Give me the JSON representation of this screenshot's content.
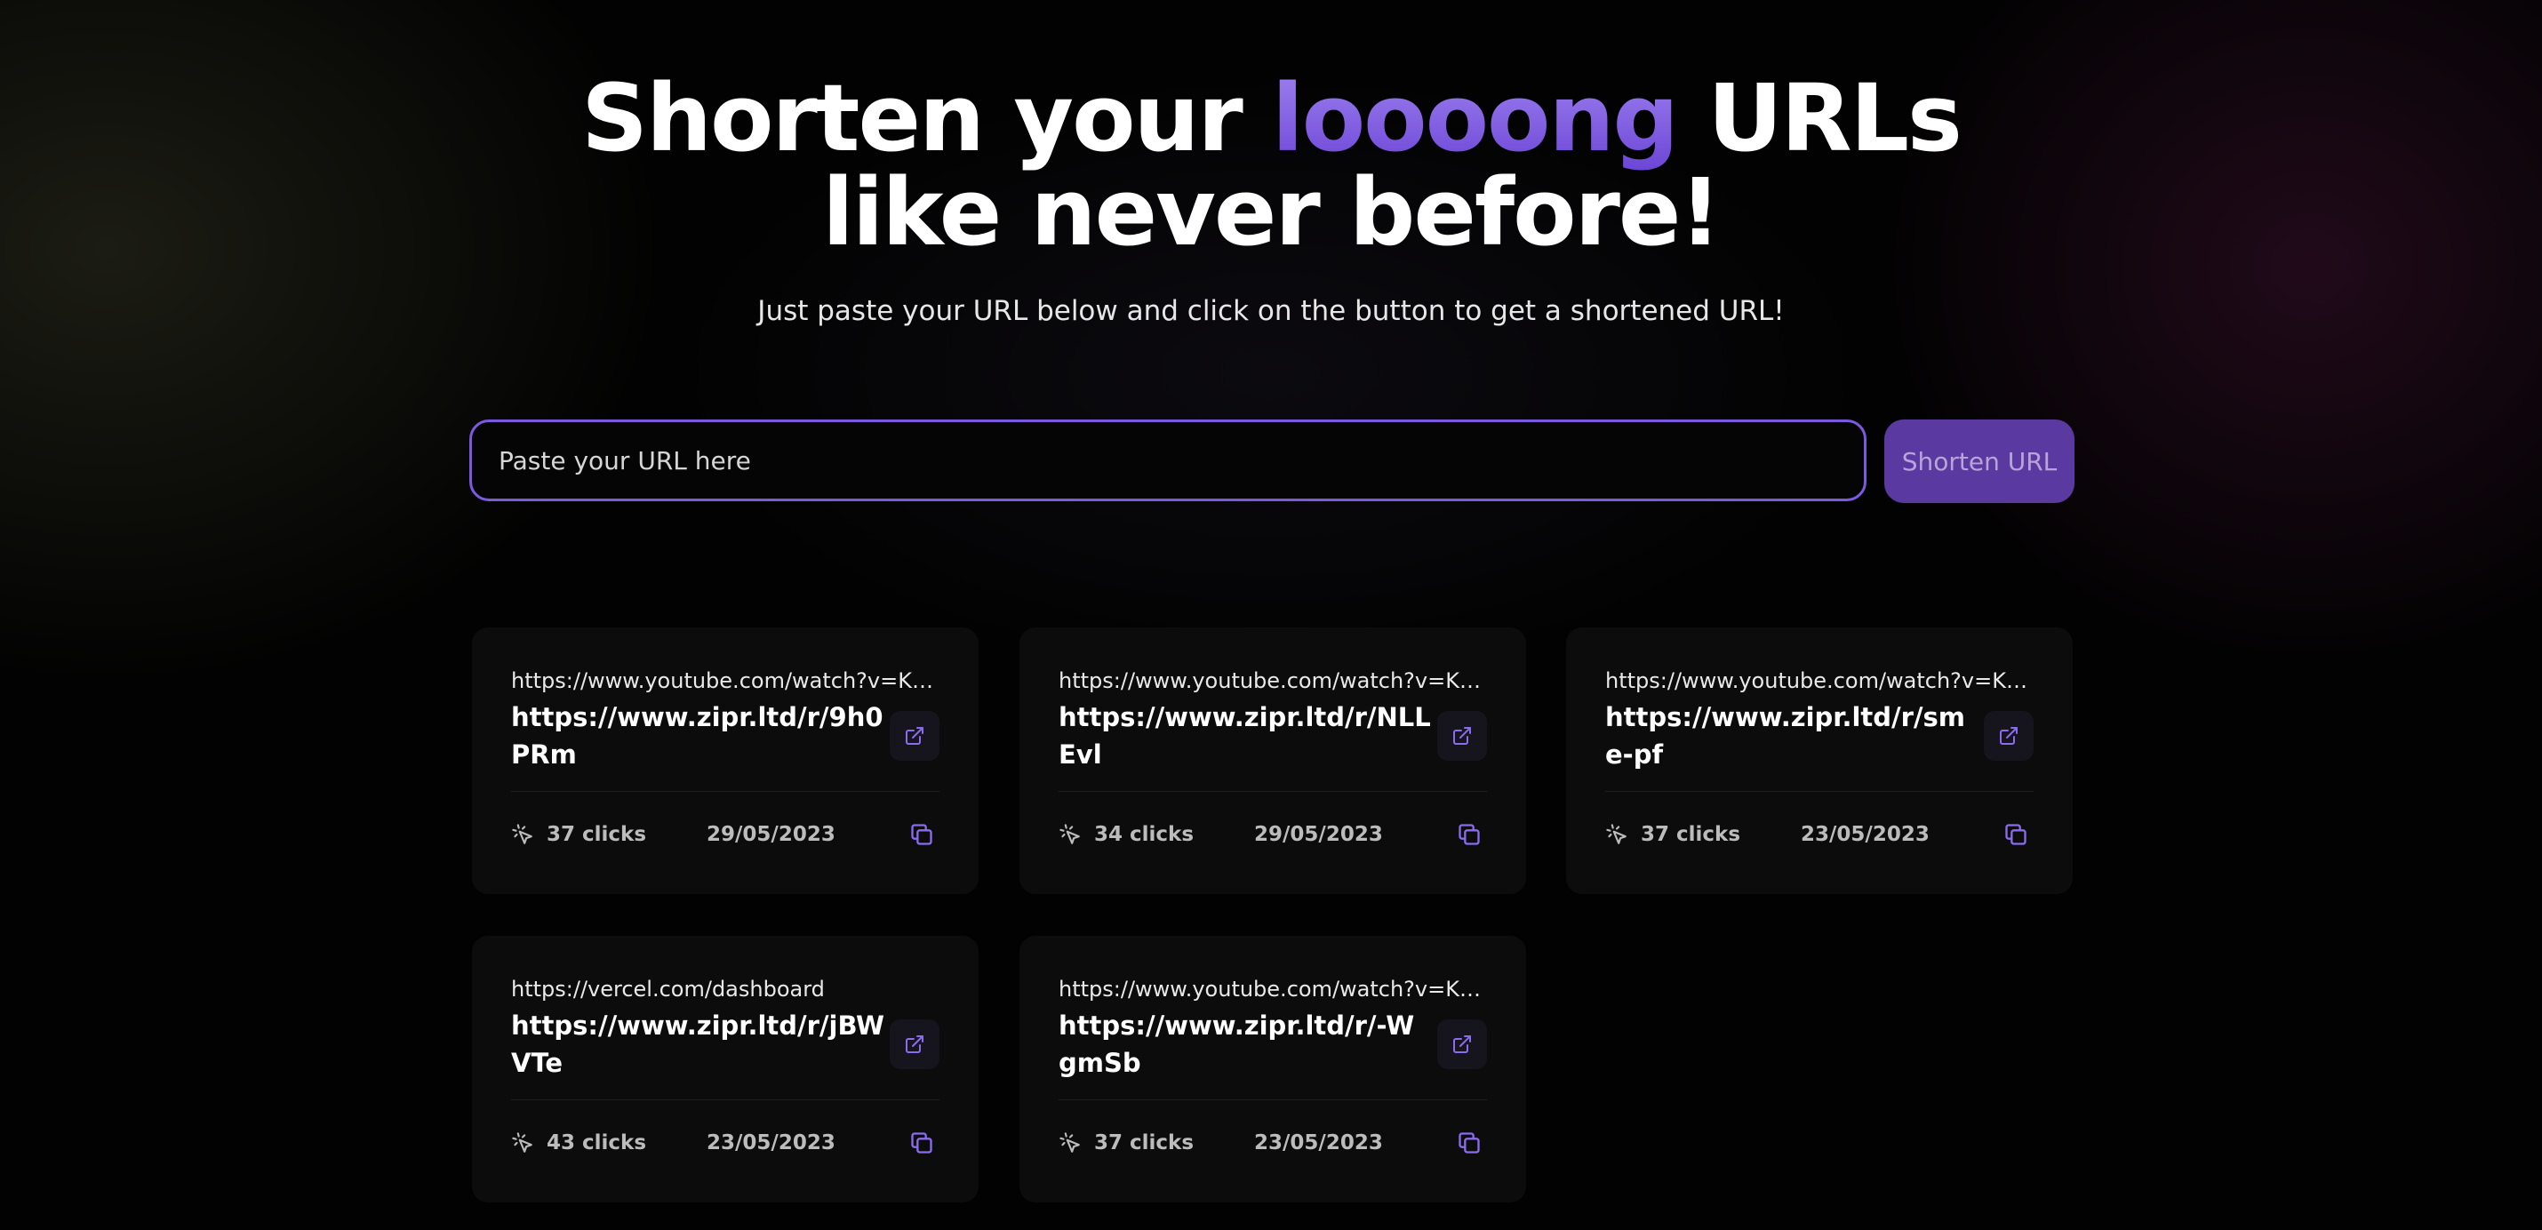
{
  "hero": {
    "title_part1": "Shorten your ",
    "title_accent": "loooong",
    "title_part2": " URLs",
    "title_line2": "like never before!",
    "subtitle": "Just paste your URL below and click on the button to get a shortened URL!"
  },
  "form": {
    "placeholder": "Paste your URL here",
    "button_label": "Shorten URL"
  },
  "colors": {
    "accent": "#7b5ae0",
    "card_bg": "#0c0c0d",
    "button_bg": "#5a3aa0"
  },
  "links": [
    {
      "original": "https://www.youtube.com/watch?v=KsQ4...",
      "short": "https://www.zipr.ltd/r/9h0PRm",
      "clicks": "37 clicks",
      "date": "29/05/2023"
    },
    {
      "original": "https://www.youtube.com/watch?v=KsQ4...",
      "short": "https://www.zipr.ltd/r/NLLEvl",
      "clicks": "34 clicks",
      "date": "29/05/2023"
    },
    {
      "original": "https://www.youtube.com/watch?v=KsQ4...",
      "short": "https://www.zipr.ltd/r/sme-pf",
      "clicks": "37 clicks",
      "date": "23/05/2023"
    },
    {
      "original": "https://vercel.com/dashboard",
      "short": "https://www.zipr.ltd/r/jBWVTe",
      "clicks": "43 clicks",
      "date": "23/05/2023"
    },
    {
      "original": "https://www.youtube.com/watch?v=KsQ4...",
      "short": "https://www.zipr.ltd/r/-WgmSb",
      "clicks": "37 clicks",
      "date": "23/05/2023"
    }
  ],
  "icons": {
    "open": "external-link-icon",
    "copy": "copy-icon",
    "clicks": "cursor-click-icon"
  }
}
